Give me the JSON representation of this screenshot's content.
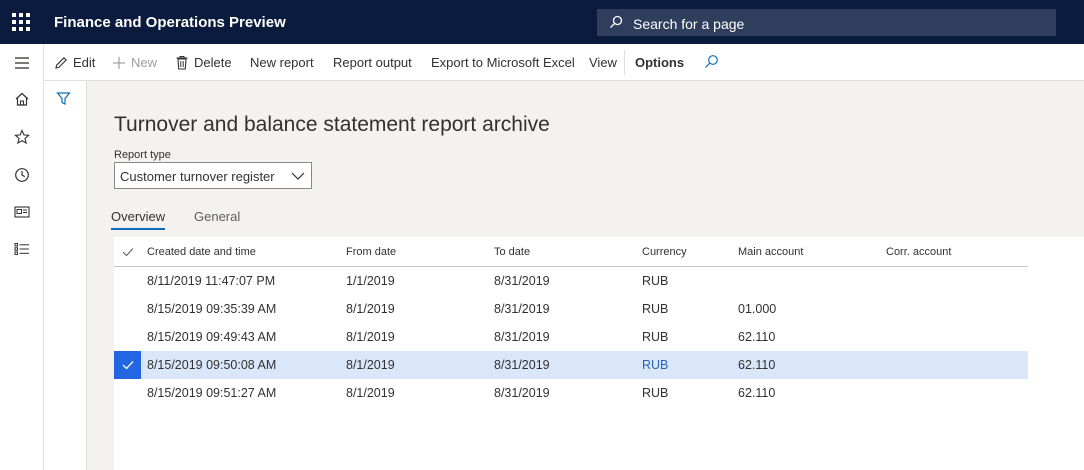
{
  "app": {
    "title": "Finance and Operations Preview"
  },
  "search": {
    "placeholder": "Search for a page"
  },
  "actions": {
    "edit": "Edit",
    "new": "New",
    "delete": "Delete",
    "new_report": "New report",
    "report_output": "Report output",
    "export_excel": "Export to Microsoft Excel",
    "view": "View",
    "options": "Options"
  },
  "page": {
    "title": "Turnover and balance statement report archive",
    "report_type_label": "Report type",
    "report_type_value": "Customer turnover register"
  },
  "tabs": [
    {
      "label": "Overview",
      "active": true
    },
    {
      "label": "General",
      "active": false
    }
  ],
  "grid": {
    "columns": [
      "Created date and time",
      "From date",
      "To date",
      "Currency",
      "Main account",
      "Corr. account"
    ],
    "rows": [
      {
        "created": "8/11/2019 11:47:07 PM",
        "from": "1/1/2019",
        "to": "8/31/2019",
        "currency": "RUB",
        "main_account": "",
        "corr_account": "",
        "selected": false
      },
      {
        "created": "8/15/2019 09:35:39 AM",
        "from": "8/1/2019",
        "to": "8/31/2019",
        "currency": "RUB",
        "main_account": "01.000",
        "corr_account": "",
        "selected": false
      },
      {
        "created": "8/15/2019 09:49:43 AM",
        "from": "8/1/2019",
        "to": "8/31/2019",
        "currency": "RUB",
        "main_account": "62.110",
        "corr_account": "",
        "selected": false
      },
      {
        "created": "8/15/2019 09:50:08 AM",
        "from": "8/1/2019",
        "to": "8/31/2019",
        "currency": "RUB",
        "main_account": "62.110",
        "corr_account": "",
        "selected": true
      },
      {
        "created": "8/15/2019 09:51:27 AM",
        "from": "8/1/2019",
        "to": "8/31/2019",
        "currency": "RUB",
        "main_account": "62.110",
        "corr_account": "",
        "selected": false
      }
    ]
  },
  "colors": {
    "topbar": "#0b1b3d",
    "accent": "#0f6cbd",
    "selected_row": "#dae6fa",
    "check_fill": "#2266e3"
  }
}
